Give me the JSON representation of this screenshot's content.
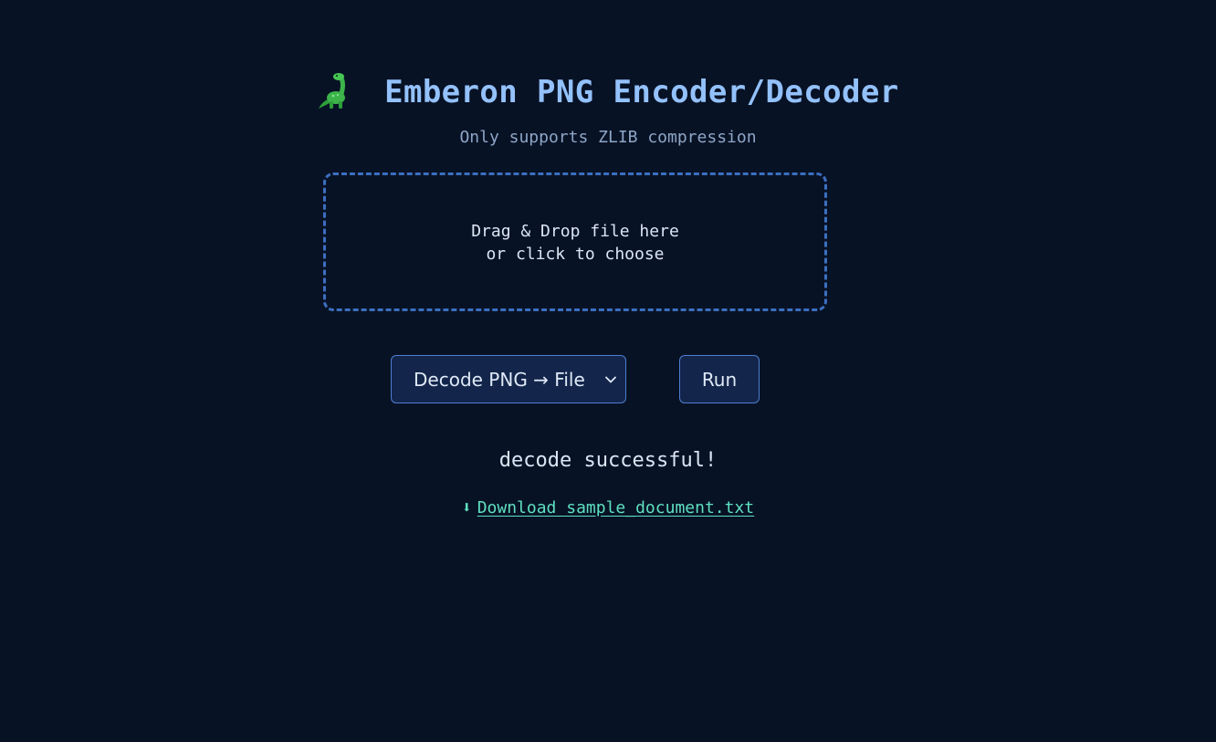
{
  "header": {
    "title": "Emberon PNG Encoder/Decoder",
    "logo_icon": "dinosaur-icon",
    "subtitle": "Only supports ZLIB compression"
  },
  "dropzone": {
    "line1": "Drag & Drop file here",
    "line2": "or click to choose"
  },
  "controls": {
    "mode_selected": "Decode PNG → File",
    "run_label": "Run"
  },
  "result": {
    "status": "decode successful!",
    "download_icon": "download-arrow-icon",
    "download_label": "Download sample_document.txt"
  },
  "colors": {
    "background": "#081225",
    "accent": "#93c1fb",
    "link": "#5ee0c0",
    "border": "#3b6fc0"
  }
}
